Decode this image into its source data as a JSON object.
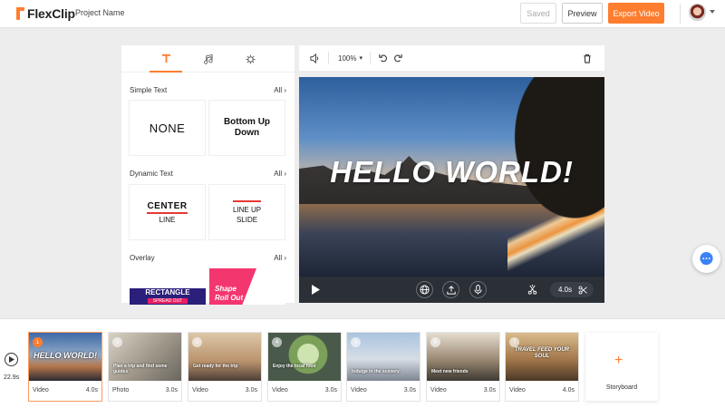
{
  "header": {
    "logo": "FlexClip",
    "project_name": "Project Name",
    "saved_label": "Saved",
    "preview_label": "Preview",
    "export_label": "Export Video"
  },
  "text_panel": {
    "tabs": [
      "text-icon",
      "music-icon",
      "effects-icon"
    ],
    "sections": [
      {
        "title": "Simple Text",
        "all": "All"
      },
      {
        "title": "Dynamic Text",
        "all": "All"
      },
      {
        "title": "Overlay",
        "all": "All"
      }
    ],
    "cards": {
      "none": "NONE",
      "bottom_up_1": "Bottom Up",
      "bottom_up_2": "Down",
      "center_1": "CENTER",
      "center_2": "LINE",
      "lineup_1": "LINE UP",
      "lineup_2": "SLIDE",
      "rectangle_1": "RECTANGLE",
      "rectangle_2": "SPREAD OUT",
      "shape_1": "Shape",
      "shape_2": "Roll Out"
    }
  },
  "video_toolbar": {
    "zoom": "100%"
  },
  "preview": {
    "overlay_text": "HELLO WORLD!",
    "clip_duration": "4.0s"
  },
  "timeline": {
    "total_duration": "22.9s",
    "clips": [
      {
        "num": "1",
        "type": "Video",
        "duration": "4.0s",
        "caption": "HELLO WORLD!"
      },
      {
        "num": "2",
        "type": "Photo",
        "duration": "3.0s",
        "caption": "Plan a trip and find some guides"
      },
      {
        "num": "3",
        "type": "Video",
        "duration": "3.0s",
        "caption": "Get ready for the trip"
      },
      {
        "num": "4",
        "type": "Video",
        "duration": "3.0s",
        "caption": "Enjoy the local food"
      },
      {
        "num": "5",
        "type": "Video",
        "duration": "3.0s",
        "caption": "Indulge in the scenery"
      },
      {
        "num": "6",
        "type": "Video",
        "duration": "3.0s",
        "caption": "Meet new friends"
      },
      {
        "num": "7",
        "type": "Video",
        "duration": "4.0s",
        "caption": "TRAVEL FEED YOUR SOUL"
      }
    ],
    "storyboard_label": "Storyboard"
  },
  "colors": {
    "accent": "#ff7d2e",
    "dark_control_bar": "#2b2f36"
  }
}
